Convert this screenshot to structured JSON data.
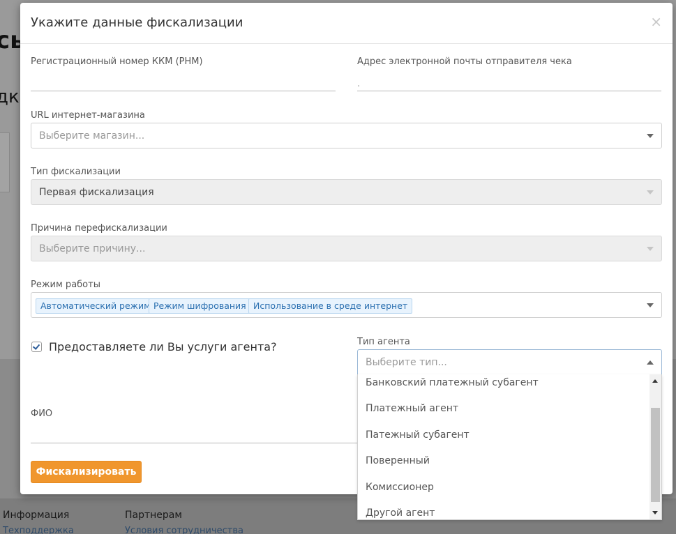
{
  "background": {
    "heading_fragment": "сь",
    "sub_fragment": "дк",
    "footer": {
      "col1_title": "Информация",
      "col1_link": "Техподдержка",
      "col2_title": "Партнерам",
      "col2_link": "Условия сотрудничества"
    }
  },
  "modal": {
    "title": "Укажите данные фискализации",
    "close_symbol": "×",
    "fields": {
      "rnm_label": "Регистрационный номер ККМ (РНМ)",
      "rnm_value": "",
      "email_label": "Адрес электронной почты отправителя чека",
      "email_value": ".",
      "url_label": "URL интернет-магазина",
      "url_placeholder": "Выберите магазин...",
      "fiscal_type_label": "Тип фискализации",
      "fiscal_type_value": "Первая фискализация",
      "refiscal_reason_label": "Причина перефискализации",
      "refiscal_reason_placeholder": "Выберите причину...",
      "mode_label": "Режим работы",
      "mode_tags": [
        "Автоматический режим",
        "Режим шифрования",
        "Использование в среде интернет"
      ],
      "agent_checkbox_label": "Предоставляете ли Вы услуги агента?",
      "agent_checkbox_checked": true,
      "agent_type_label": "Тип агента",
      "agent_type_placeholder": "Выберите тип...",
      "fio_label": "ФИО"
    },
    "submit_label": "Фискализировать",
    "agent_type_options": [
      "Банковский платежный субагент",
      "Платежный агент",
      "Патежный субагент",
      "Поверенный",
      "Комиссионер",
      "Другой агент"
    ]
  },
  "colors": {
    "accent": "#f0962d",
    "tag_bg": "#e8f3fd",
    "tag_text": "#2a6fb0",
    "overlay": "#8b8b8b"
  }
}
